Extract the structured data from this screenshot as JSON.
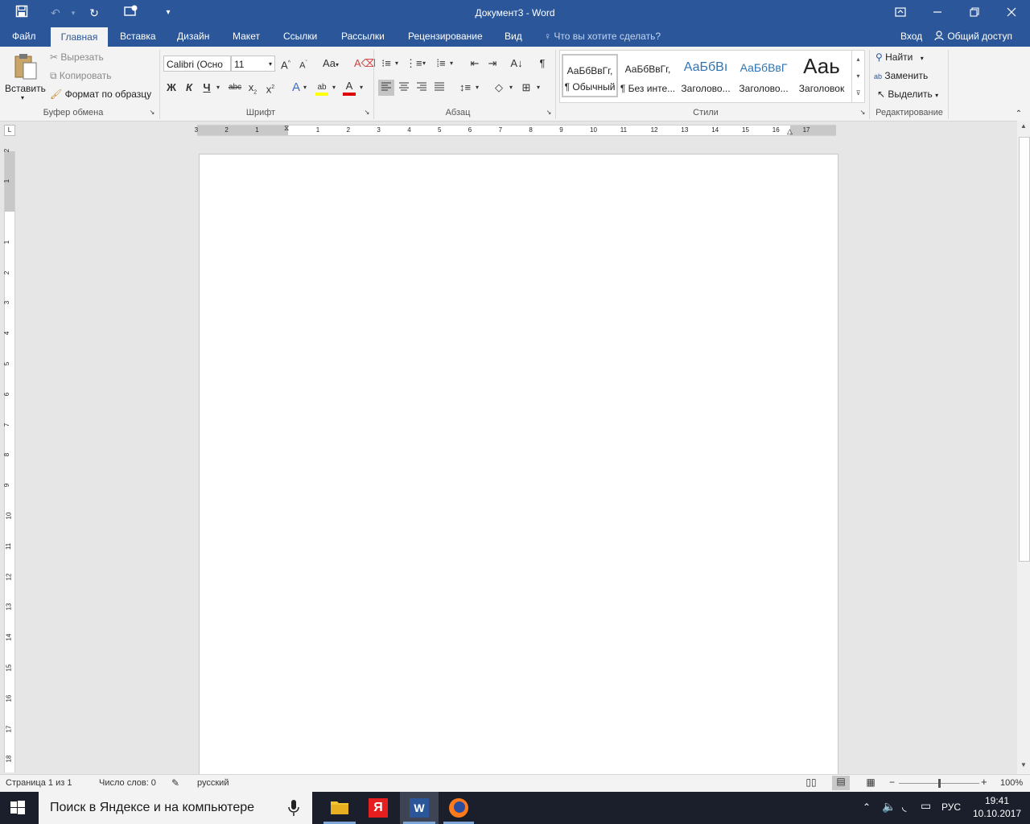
{
  "window": {
    "title": "Документ3 - Word",
    "qat": {
      "save_icon": "save-icon",
      "undo_icon": "undo-icon",
      "redo_icon": "redo-icon",
      "touch_icon": "touch-mode-icon",
      "customize_icon": "customize-qat-icon"
    },
    "controls": {
      "ribbon_display": "ribbon-display-icon",
      "minimize": "minimize-icon",
      "restore": "restore-icon",
      "close": "close-icon"
    }
  },
  "tabs": {
    "file": "Файл",
    "home": "Главная",
    "insert": "Вставка",
    "design": "Дизайн",
    "layout": "Макет",
    "references": "Ссылки",
    "mailings": "Рассылки",
    "review": "Рецензирование",
    "view": "Вид",
    "tell_me": "Что вы хотите сделать?",
    "signin": "Вход",
    "share": "Общий доступ"
  },
  "clipboard": {
    "paste": "Вставить",
    "cut": "Вырезать",
    "copy": "Копировать",
    "format_painter": "Формат по образцу",
    "label": "Буфер обмена"
  },
  "font": {
    "name": "Calibri (Осно",
    "size": "11",
    "bold": "Ж",
    "italic": "К",
    "underline": "Ч",
    "strike": "abc",
    "label": "Шрифт",
    "highlight_color": "#ffff00",
    "font_color": "#e00000"
  },
  "paragraph": {
    "label": "Абзац",
    "pilcrow": "¶"
  },
  "styles": {
    "label": "Стили",
    "items": [
      {
        "sample": "АаБбВвГг,",
        "name": "¶ Обычный",
        "color": "#000000"
      },
      {
        "sample": "АаБбВвГг,",
        "name": "¶ Без инте...",
        "color": "#000000"
      },
      {
        "sample": "АаБбВı",
        "name": "Заголово...",
        "color": "#2e74b5"
      },
      {
        "sample": "АаБбВвГ",
        "name": "Заголово...",
        "color": "#2e74b5"
      },
      {
        "sample": "Ааь",
        "name": "Заголовок",
        "color": "#000000"
      }
    ]
  },
  "editing": {
    "label": "Редактирование",
    "find": "Найти",
    "replace": "Заменить",
    "select": "Выделить"
  },
  "hruler_numbers": [
    "3",
    "2",
    "1",
    "1",
    "2",
    "3",
    "4",
    "5",
    "6",
    "7",
    "8",
    "9",
    "10",
    "11",
    "12",
    "13",
    "14",
    "15",
    "16",
    "17"
  ],
  "vruler_numbers": [
    "2",
    "1",
    "1",
    "2",
    "3",
    "4",
    "5",
    "6",
    "7",
    "8",
    "9",
    "10",
    "11",
    "12",
    "13",
    "14",
    "15",
    "16",
    "17",
    "18"
  ],
  "status": {
    "page": "Страница 1 из 1",
    "words": "Число слов: 0",
    "language": "русский",
    "zoom": "100%",
    "zoom_level": 1.0
  },
  "taskbar": {
    "search_placeholder": "Поиск в Яндексе и на компьютере",
    "language": "РУС",
    "time": "19:41",
    "date": "10.10.2017"
  },
  "colors": {
    "accent": "#2b579a",
    "taskbar": "#1b1f2c"
  }
}
